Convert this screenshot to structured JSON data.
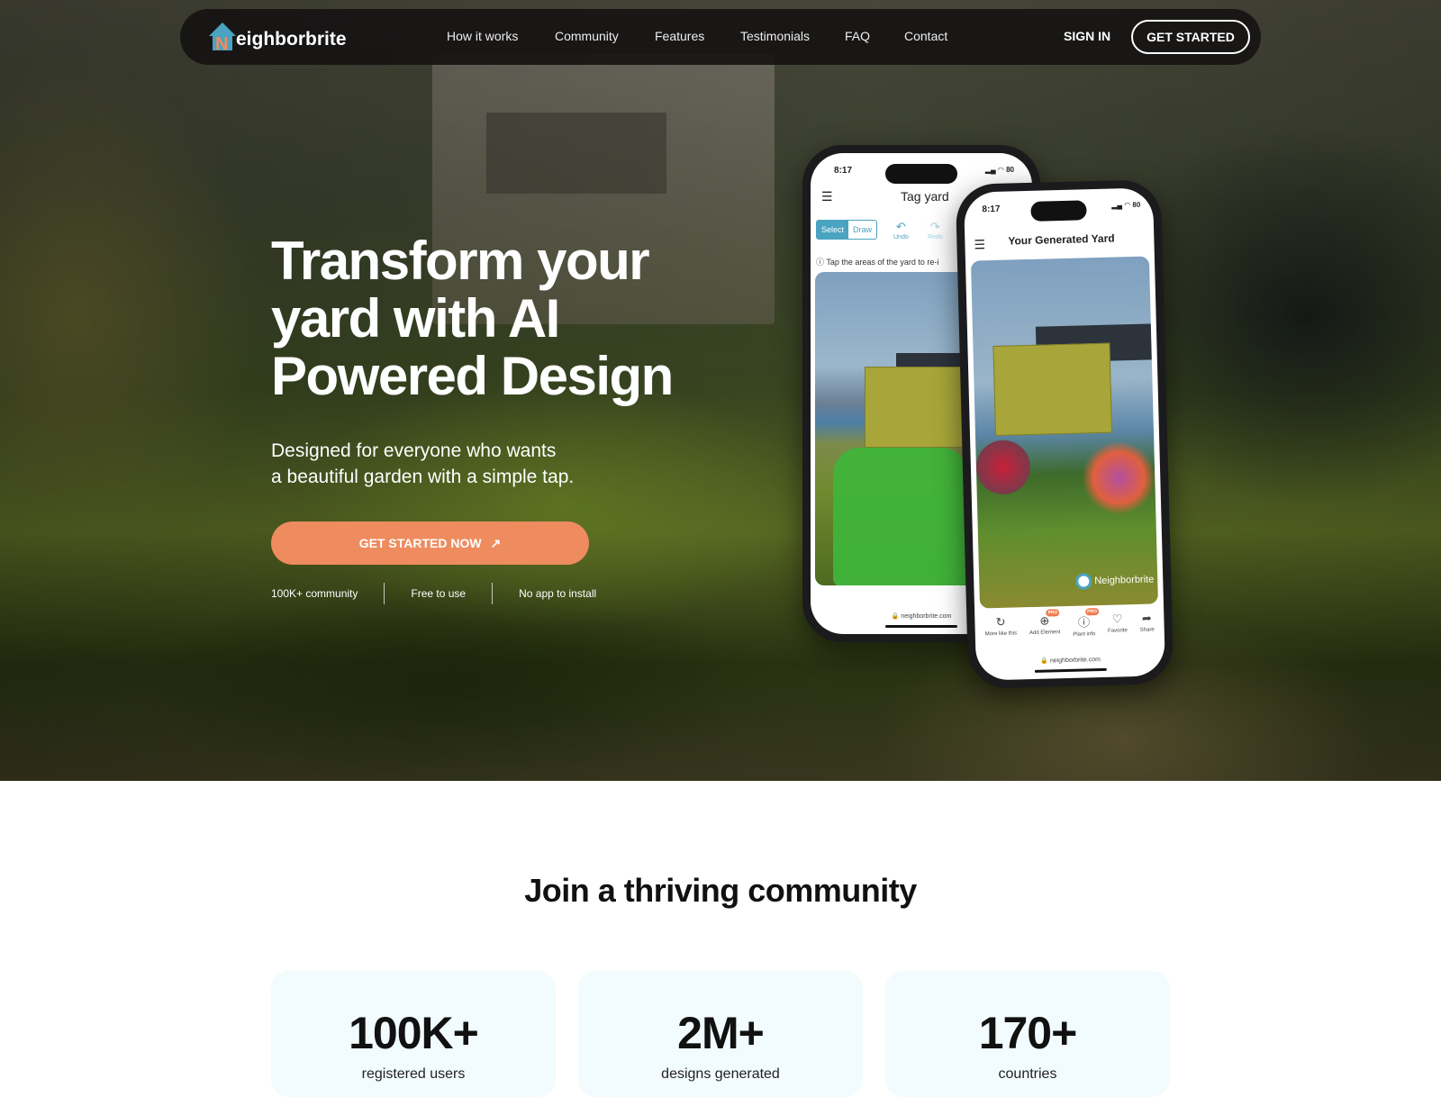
{
  "brand": {
    "name": "eighborbrite",
    "logo_letter": "N",
    "accent": "#ee8c5f",
    "logo_blue": "#4aa3c0"
  },
  "nav": {
    "links": [
      "How it works",
      "Community",
      "Features",
      "Testimonials",
      "FAQ",
      "Contact"
    ],
    "sign_in": "SIGN IN",
    "get_started": "GET STARTED"
  },
  "hero": {
    "title": "Transform your yard with AI Powered Design",
    "subtitle_line1": "Designed for everyone who wants",
    "subtitle_line2": "a beautiful garden with a simple tap.",
    "cta": "GET STARTED NOW",
    "cta_icon": "arrow-up-right-icon",
    "features": [
      "100K+ community",
      "Free to use",
      "No app to install"
    ]
  },
  "phone_back": {
    "time": "8:17",
    "battery": "80",
    "title": "Tag yard",
    "seg_select": "Select",
    "seg_draw": "Draw",
    "undo": "Undo",
    "redo": "Redo",
    "hint": "Tap the areas of the yard to re-i",
    "url": "neighborbrite.com"
  },
  "phone_front": {
    "time": "8:17",
    "battery": "80",
    "title": "Your Generated Yard",
    "watermark": "Neighborbrite",
    "actions": [
      {
        "label": "More like this",
        "icon": "refresh-icon"
      },
      {
        "label": "Add Element",
        "icon": "plus-circle-icon",
        "badge": "PRO"
      },
      {
        "label": "Plant info",
        "icon": "info-icon",
        "badge": "PRO"
      },
      {
        "label": "Favorite",
        "icon": "heart-icon"
      },
      {
        "label": "Share",
        "icon": "share-icon"
      }
    ],
    "url": "neighborbrite.com"
  },
  "community": {
    "heading": "Join a thriving community",
    "stats": [
      {
        "value": "100K+",
        "label": "registered users"
      },
      {
        "value": "2M+",
        "label": "designs generated"
      },
      {
        "value": "170+",
        "label": "countries"
      }
    ]
  }
}
